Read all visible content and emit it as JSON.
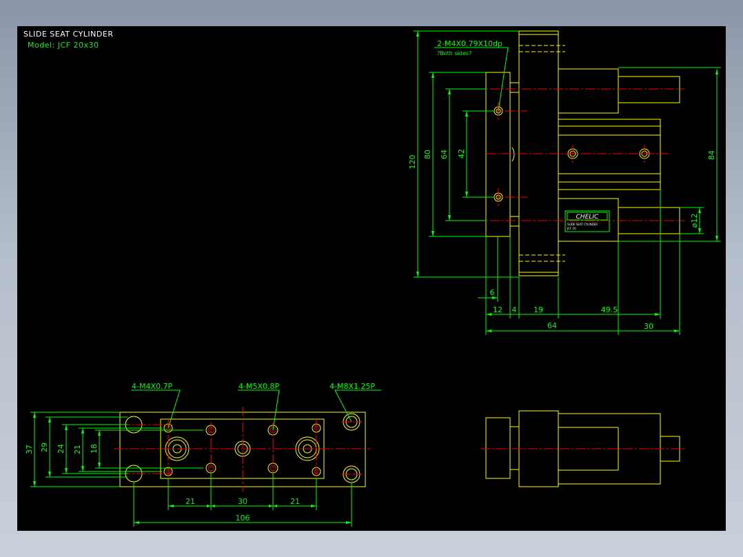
{
  "title": "SLIDE SEAT CYLINDER",
  "model": "Model: JCF 20x30",
  "colors": {
    "background": "#000000",
    "outline": "#ffff00",
    "centerline": "#ff0000",
    "dimension": "#00ff00",
    "frame": "#8a96a8"
  },
  "callouts": {
    "side_holes": "2-M4X0.79X10dp",
    "side_holes_note": "?Both sides?",
    "m4": "4-M4X0.7P",
    "m5": "4-M5X0.8P",
    "m8": "4-M8X1.25P"
  },
  "nameplate": {
    "brand": "CHELIC",
    "line1": "SLIDE SEAT CYLINDER",
    "line2": "JCF 20"
  },
  "dims_top": {
    "d120": "120",
    "d80": "80",
    "d64v": "64",
    "d42": "42",
    "d84": "84",
    "d12dia": "ø12",
    "d6": "6",
    "d12": "12",
    "d4": "4",
    "d19": "19",
    "d49_5": "49.5",
    "d64h": "64",
    "d30": "30"
  },
  "dims_bottom": {
    "d37": "37",
    "d29": "29",
    "d24": "24",
    "d21v": "21",
    "d18": "18",
    "d21a": "21",
    "d30": "30",
    "d21b": "21",
    "d106": "106"
  }
}
